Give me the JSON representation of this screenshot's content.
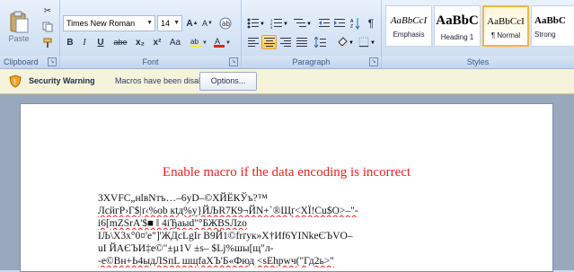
{
  "ribbon": {
    "clipboard": {
      "paste_label": "Paste",
      "group_label": "Clipboard"
    },
    "font": {
      "font_name": "Times New Roman",
      "font_size": "14",
      "group_label": "Font",
      "bold": "B",
      "italic": "I",
      "underline": "U",
      "strike": "abe",
      "subscript": "x₂",
      "superscript": "x²",
      "change_case": "Aa"
    },
    "paragraph": {
      "group_label": "Paragraph"
    },
    "styles": {
      "group_label": "Styles",
      "items": [
        {
          "sample": "AaBbCcI",
          "name": "Emphasis"
        },
        {
          "sample": "AaBbC",
          "name": "Heading 1"
        },
        {
          "sample": "AaBbCcI",
          "name": "¶ Normal"
        },
        {
          "sample": "AaBbC",
          "name": "Strong"
        }
      ]
    }
  },
  "security_bar": {
    "title": "Security Warning",
    "message": "Macros have been disabled.",
    "options_button": "Options..."
  },
  "document": {
    "heading": "Enable macro if the data encoding is incorrect",
    "lines": [
      "3XVFC„нlвNтъ…–6уD–©ХЙЁКЎъ?™",
      "ЛсйгР›Г$|ґ‹%оb кtд%у}ЙЉR7К9¬ЙN+`®Щґ<ХЇ!Cu$O>–\"-",
      "і6[mZSrA'$■ ‖ 4іЂаыd\"°БЖBSЛzо",
      "IЉ\\X3х°0¤'е\"]'ЖДсLgIr   В9Й1©frґук»Х†Иf6YINkеЄЪVО–",
      "uI ЙАЄЪИ‡е©\"±µ1V   ±s– $Lj%шы[щ\"л-",
      "-е©Вн+Ь4ыдЛSпL шщfаХЪ'Б«Фюд <sЕhрwч(\"Гд2ь>\""
    ]
  }
}
